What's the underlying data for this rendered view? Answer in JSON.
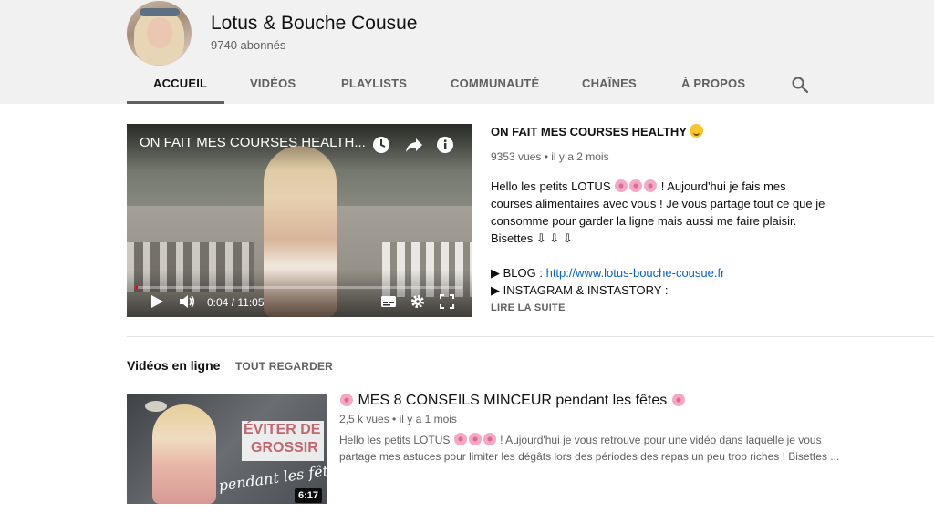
{
  "channel": {
    "name": "Lotus & Bouche Cousue",
    "subscribers": "9740 abonnés"
  },
  "tabs": [
    {
      "label": "ACCUEIL",
      "active": true
    },
    {
      "label": "VIDÉOS"
    },
    {
      "label": "PLAYLISTS"
    },
    {
      "label": "COMMUNAUTÉ"
    },
    {
      "label": "CHAÎNES"
    },
    {
      "label": "À PROPOS"
    }
  ],
  "icons": {
    "search": "search-icon",
    "watch_later": "clock-icon",
    "share": "share-icon",
    "info": "info-icon",
    "play": "play-icon",
    "volume": "volume-icon",
    "subtitles": "subtitles-icon",
    "settings": "gear-icon",
    "fullscreen": "fullscreen-icon"
  },
  "featured": {
    "overlay_title": "ON FAIT MES COURSES HEALTH...",
    "time": "0:04 / 11:05",
    "progress": 0.006,
    "title": "ON FAIT MES COURSES HEALTHY",
    "title_emoji": "smiling-face-emoji",
    "meta": "9353 vues • il y a 2 mois",
    "desc_line1_pre": "Hello les petits LOTUS",
    "desc_line1_post": "! Aujourd'hui je fais mes",
    "desc_line2": "courses alimentaires avec vous ! Je vous partage tout ce que je",
    "desc_line3": "consomme pour garder la ligne mais aussi me faire plaisir.",
    "desc_line4": "Bisettes ⇩ ⇩ ⇩",
    "blog_label": "▶ BLOG :",
    "blog_url": "http://www.lotus-bouche-cousue.fr",
    "instagram_label": "▶ INSTAGRAM & INSTASTORY :",
    "read_more": "LIRE LA SUITE"
  },
  "section": {
    "title": "Vidéos en ligne",
    "link": "TOUT REGARDER"
  },
  "video2": {
    "thumb_text1": "ÉVITER DE",
    "thumb_text2": "GROSSIR",
    "thumb_script": "pendant les fêtes",
    "duration": "6:17",
    "title": "MES 8 CONSEILS MINCEUR pendant les fêtes",
    "meta": "2,5 k vues • il y a 1 mois",
    "desc_pre": "Hello les petits LOTUS",
    "desc_post": "! Aujourd'hui je vous retrouve pour une vidéo dans laquelle je vous partage mes astuces pour limiter les dégâts lors des périodes des repas un peu trop riches ! Bisettes ..."
  },
  "colors": {
    "header_bg": "#f1f1f1",
    "link": "#065fd4",
    "progress": "#ff0000",
    "muted_text": "#606060"
  }
}
